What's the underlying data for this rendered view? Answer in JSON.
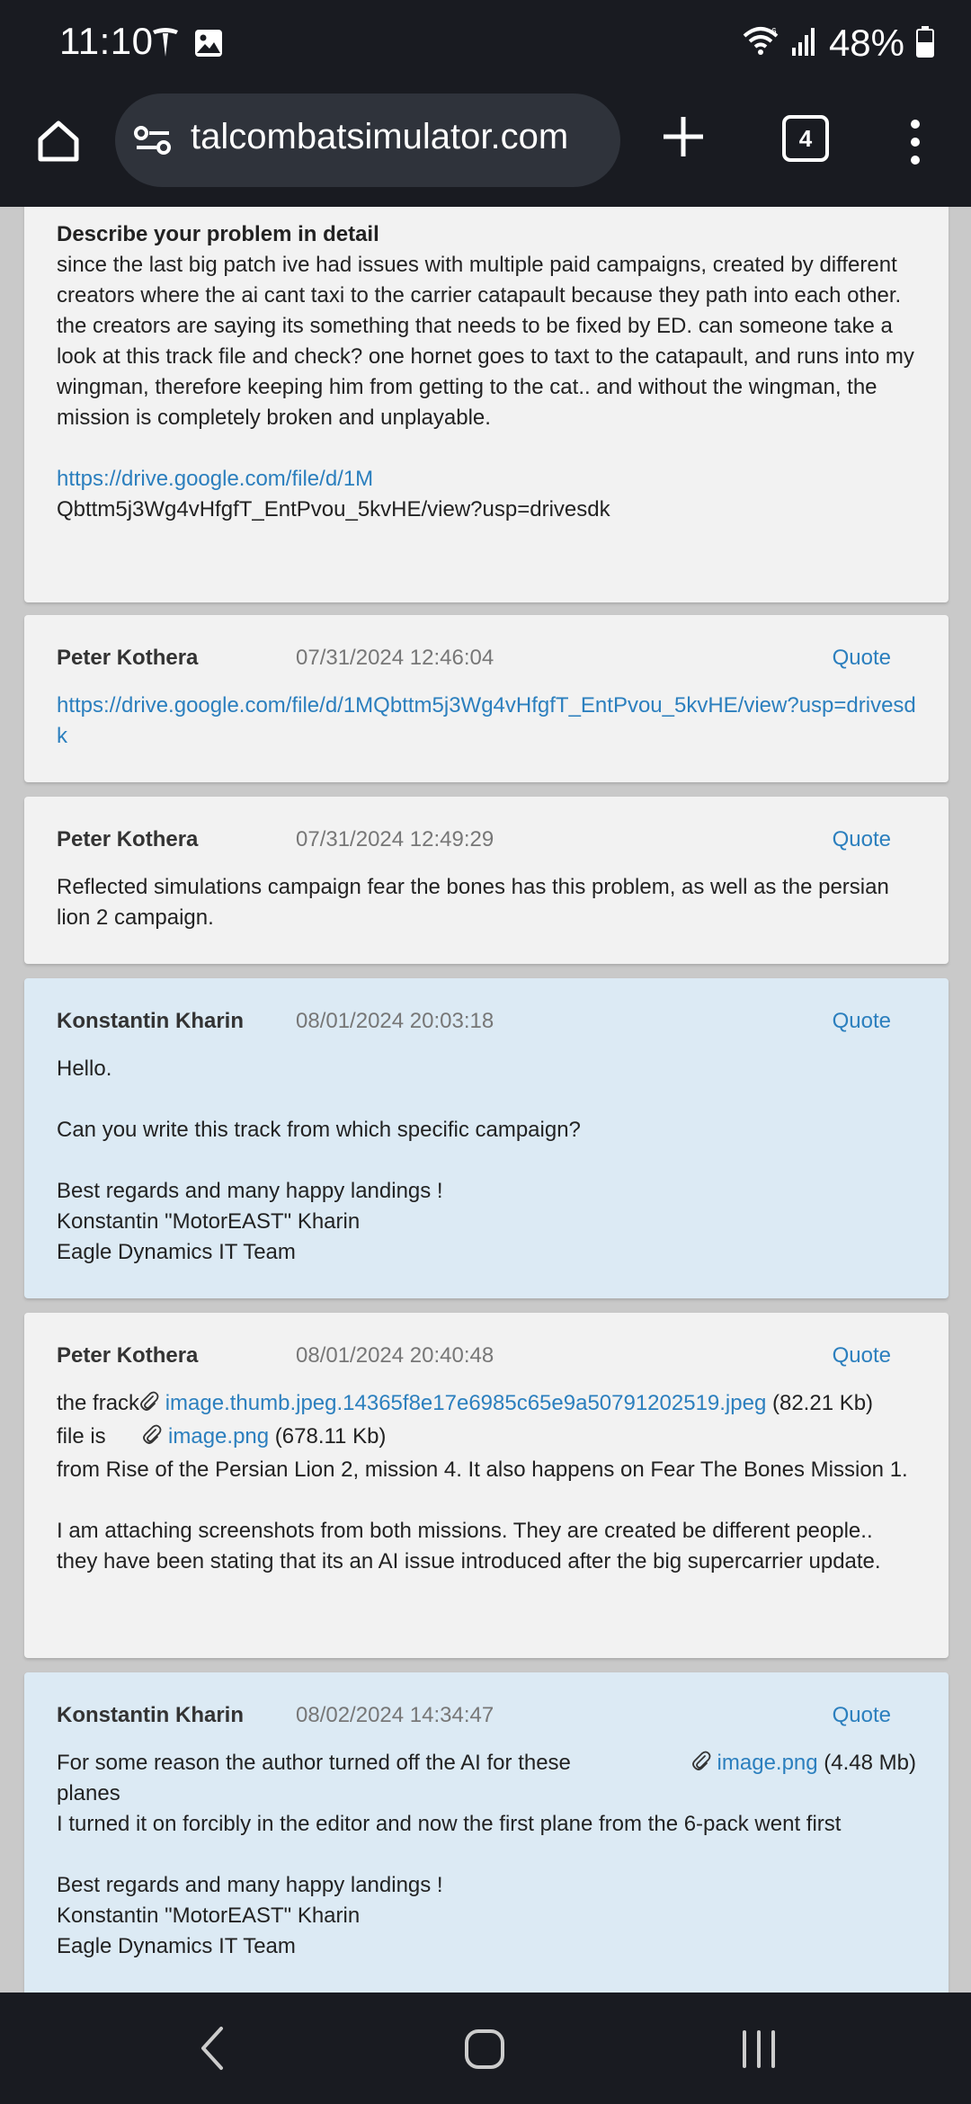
{
  "status_bar": {
    "time": "11:10",
    "battery": "48%",
    "icons": [
      "tesla-icon",
      "gallery-icon",
      "wifi-icon",
      "signal-icon",
      "battery-icon"
    ]
  },
  "browser": {
    "url": "talcombatsimulator.com",
    "tab_count": "4",
    "icons": [
      "home-icon",
      "site-settings-icon",
      "plus-icon",
      "more-vert-icon"
    ]
  },
  "problem": {
    "heading": "Describe your problem in detail",
    "text": "since the last big patch ive had issues with multiple paid campaigns, created by different creators where the ai cant taxi to the carrier catapault because they path into each other.  the creators are saying its something that needs to be fixed by ED.  can someone take a look at this track file and check?  one hornet goes to taxt to the catapault, and runs  into my wingman, therefore keeping him from getting to the cat.. and without the wingman, the mission is completely broken and unplayable.",
    "link_part1": "https://drive.google.com/file/d/1M",
    "link_part2": "Qbttm5j3Wg4vHfgfT_EntPvou_5kvHE/view?usp=drivesdk"
  },
  "comments": [
    {
      "author": "Peter Kothera",
      "date": "07/31/2024 12:46:04",
      "quote_label": "Quote",
      "link": "https://drive.google.com/file/d/1MQbttm5j3Wg4vHfgfT_EntPvou_5kvHE/view?usp=drivesdk"
    },
    {
      "author": "Peter Kothera",
      "date": "07/31/2024 12:49:29",
      "quote_label": "Quote",
      "text": "Reflected simulations campaign fear the bones has this problem, as well as the persian lion 2 campaign."
    },
    {
      "author": "Konstantin Kharin",
      "date": "08/01/2024 20:03:18",
      "quote_label": "Quote",
      "greeting": "Hello.",
      "question": "Can you write this track from which specific campaign?",
      "sign1": "Best regards and many happy landings !",
      "sign2": "Konstantin \"MotorEAST\" Kharin",
      "sign3": "Eagle Dynamics IT Team"
    },
    {
      "author": "Peter Kothera",
      "date": "08/01/2024 20:40:48",
      "quote_label": "Quote",
      "line1_prefix": "the frack",
      "line2_prefix": "file is",
      "attachments": [
        {
          "name": "image.thumb.jpeg.14365f8e17e6985c65e9a50791202519.jpeg",
          "size": "(82.21 Kb)"
        },
        {
          "name": "image.png",
          "size": "(678.11 Kb)"
        }
      ],
      "text1": "from Rise of the Persian Lion 2, mission 4.  It also happens on Fear The Bones Mission 1.",
      "text2": "I am attaching screenshots from both missions.  They are created be different people.. they have been stating that its an AI issue introduced after the big supercarrier update."
    },
    {
      "author": "Konstantin Kharin",
      "date": "08/02/2024 14:34:47",
      "quote_label": "Quote",
      "line1": "For some reason the author turned off the AI for these",
      "line1b": "planes",
      "attachment": {
        "name": "image.png",
        "size": "(4.48 Mb)"
      },
      "line2": "I turned it on forcibly in the editor and now the first plane from the 6-pack went first",
      "sign1": "Best regards and many happy landings !",
      "sign2": "Konstantin \"MotorEAST\" Kharin",
      "sign3": "Eagle Dynamics IT Team"
    }
  ],
  "nav_bar": {
    "icons": [
      "back-icon",
      "home-nav-icon",
      "recent-apps-icon"
    ]
  },
  "colors": {
    "link": "#2b7fbe",
    "card": "#f2f2f2",
    "card_staff": "#dceaf4",
    "bars": "#191b21"
  }
}
